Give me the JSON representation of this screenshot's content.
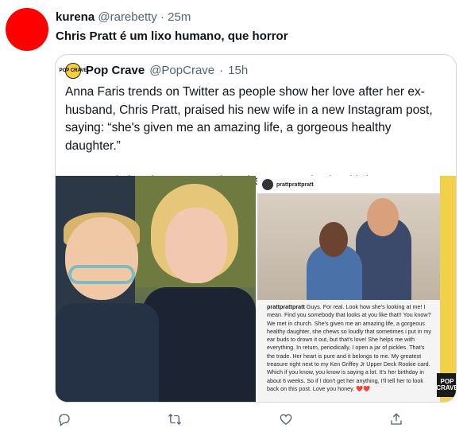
{
  "tweet": {
    "author_name": "kurena",
    "author_handle": "@rarebetty",
    "separator": "·",
    "time": "25m",
    "text": "Chris Pratt é um lixo humano, que horror",
    "avatar_color": "#ff0000"
  },
  "quoted": {
    "logo_text": "POP CRAVE",
    "author_name": "Pop Crave",
    "author_handle": "@PopCrave",
    "separator": "·",
    "time": "15h",
    "paragraph1": "Anna Faris trends on Twitter as people show her love after her ex-husband, Chris Pratt, praised his new wife in a new Instagram post, saying: “she's given me an amazing life, a gorgeous healthy daughter.”",
    "paragraph2": "Anna Faris has been open about her son Jack's health issues.",
    "media": {
      "insta_username": "prattprattpratt",
      "caption_username": "prattprattpratt",
      "caption_text": "Guys. For real. Look how she's looking at me! I mean. Find you somebody that looks at you like that!! You know? We met in church. She's given me an amazing life, a gorgeous healthy daughter, she chews so loudly that sometimes i put in my ear buds to drown it out, but that's love! She helps me with everything. In return, periodically, I open a jar of pickles. That's the trade. Her heart is pure and it belongs to me. My greatest treasure right next to my Ken Griffey Jr Upper Deck Rookie card. Which if you know, you know is saying a lot. It's her birthday in about 6 weeks. So if I don't get her anything, I'll tell her to look back on this post. Love you honey. ❤️❤️",
      "badge_text": "POP CRAVE"
    }
  },
  "actions": {
    "reply": "reply-icon",
    "retweet": "retweet-icon",
    "like": "like-icon",
    "share": "share-icon",
    "icon_color": "#536471"
  }
}
